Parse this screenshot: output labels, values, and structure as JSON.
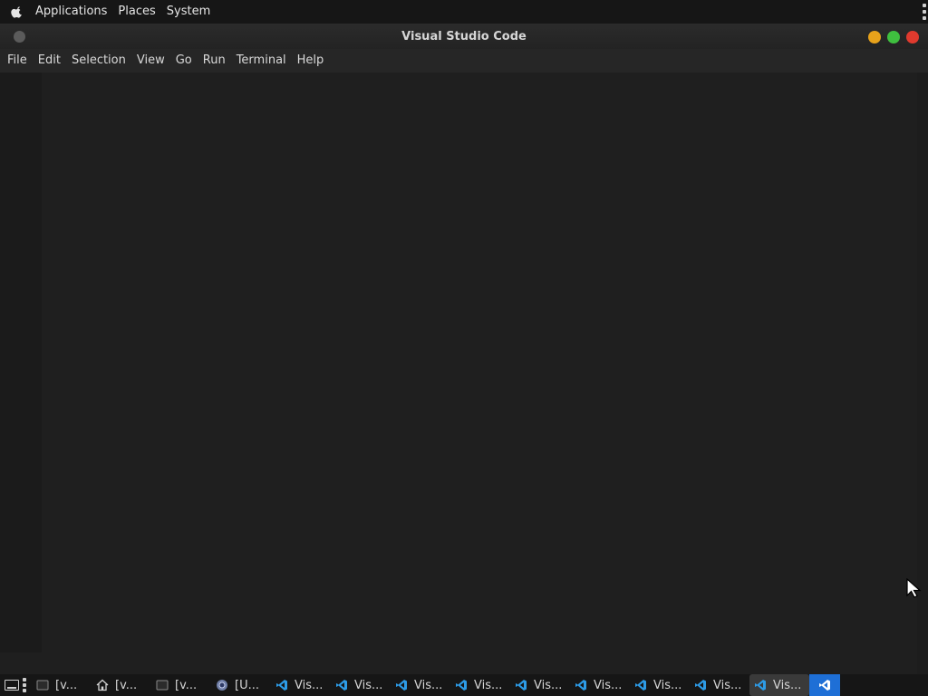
{
  "top_panel": {
    "menus": [
      "Applications",
      "Places",
      "System"
    ],
    "logo_icon": "apple-logo-icon"
  },
  "window": {
    "title": "Visual Studio Code",
    "menu": [
      "File",
      "Edit",
      "Selection",
      "View",
      "Go",
      "Run",
      "Terminal",
      "Help"
    ],
    "controls": {
      "minimize_color": "#e7a21b",
      "maximize_color": "#3fbf3f",
      "close_color": "#e03a2e"
    }
  },
  "taskbar": {
    "items": [
      {
        "label": "[v...",
        "icon": "terminal-icon"
      },
      {
        "label": "[v...",
        "icon": "home-folder-icon"
      },
      {
        "label": "[v...",
        "icon": "terminal-icon"
      },
      {
        "label": "[U...",
        "icon": "chrome-icon"
      },
      {
        "label": "Vis...",
        "icon": "vscode-icon"
      },
      {
        "label": "Vis...",
        "icon": "vscode-icon"
      },
      {
        "label": "Vis...",
        "icon": "vscode-icon"
      },
      {
        "label": "Vis...",
        "icon": "vscode-icon"
      },
      {
        "label": "Vis...",
        "icon": "vscode-icon"
      },
      {
        "label": "Vis...",
        "icon": "vscode-icon"
      },
      {
        "label": "Vis...",
        "icon": "vscode-icon"
      },
      {
        "label": "Vis...",
        "icon": "vscode-icon"
      },
      {
        "label": "Vis...",
        "icon": "vscode-icon"
      }
    ],
    "accent": "#1e6fd6"
  }
}
